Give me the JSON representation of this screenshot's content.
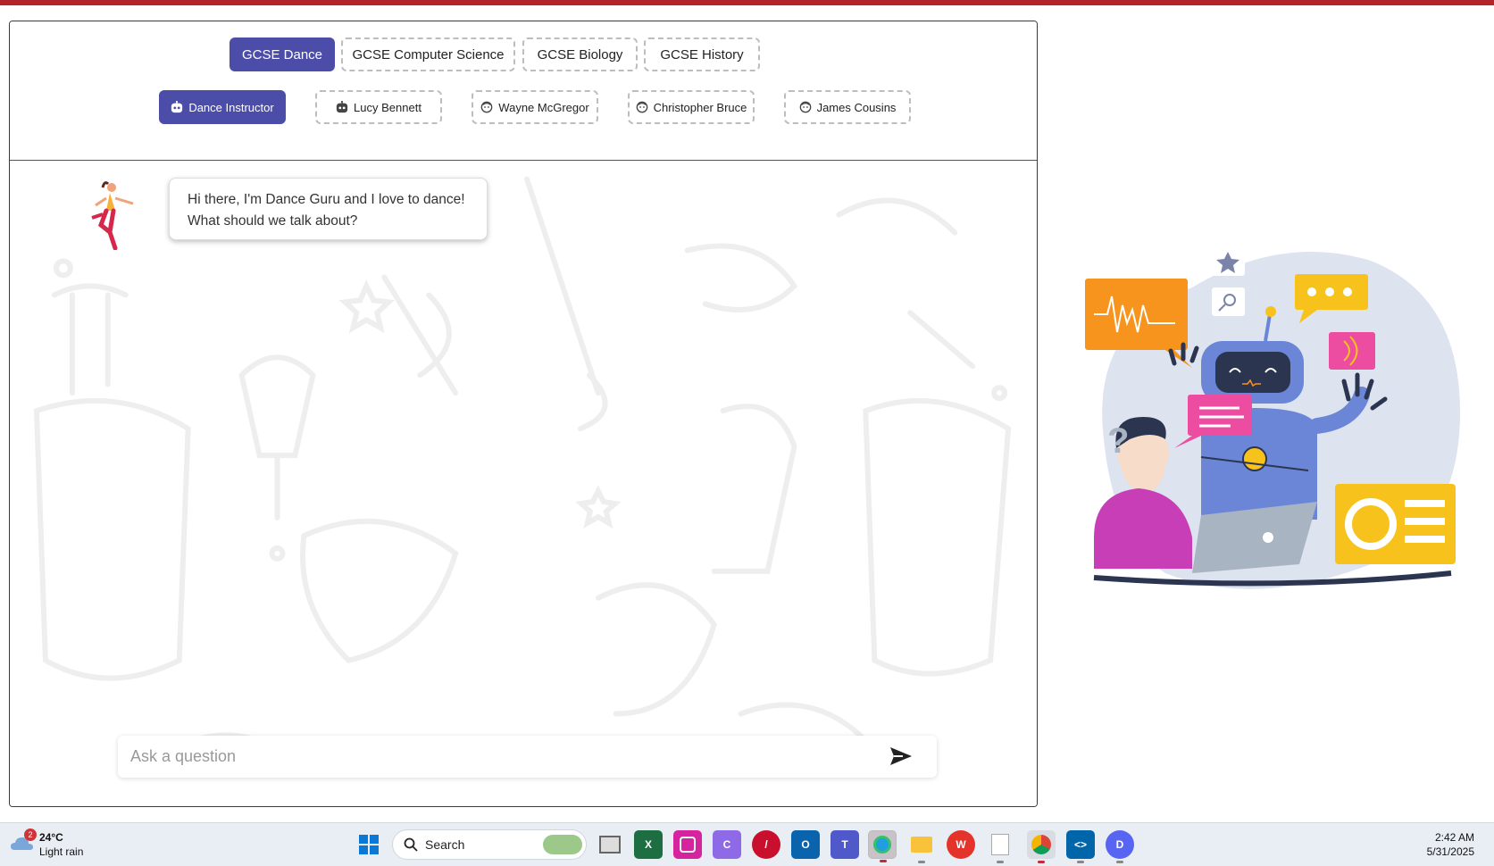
{
  "subjects": [
    {
      "label": "GCSE Dance",
      "active": true
    },
    {
      "label": "GCSE Computer Science",
      "active": false
    },
    {
      "label": "GCSE Biology",
      "active": false
    },
    {
      "label": "GCSE History",
      "active": false
    }
  ],
  "personas": [
    {
      "label": "Dance Instructor",
      "active": true,
      "icon": "robot-face-icon"
    },
    {
      "label": "Lucy Bennett",
      "active": false,
      "icon": "robot-face-icon"
    },
    {
      "label": "Wayne McGregor",
      "active": false,
      "icon": "person-face-icon"
    },
    {
      "label": "Christopher Bruce",
      "active": false,
      "icon": "person-face-icon"
    },
    {
      "label": "James Cousins",
      "active": false,
      "icon": "person-face-icon"
    }
  ],
  "chat": {
    "messages": [
      {
        "sender": "bot",
        "lines": [
          "Hi there, I'm Dance Guru and I love to dance!",
          "What should we talk about?"
        ]
      }
    ]
  },
  "input": {
    "placeholder": "Ask a question",
    "value": ""
  },
  "colors": {
    "accent": "#4b4da8",
    "top_bar": "#b3242b"
  },
  "taskbar": {
    "weather": {
      "temp": "24°C",
      "condition": "Light rain",
      "badge": "2"
    },
    "search_label": "Search",
    "clock": {
      "time": "2:42 AM",
      "date": "5/31/2025"
    }
  }
}
